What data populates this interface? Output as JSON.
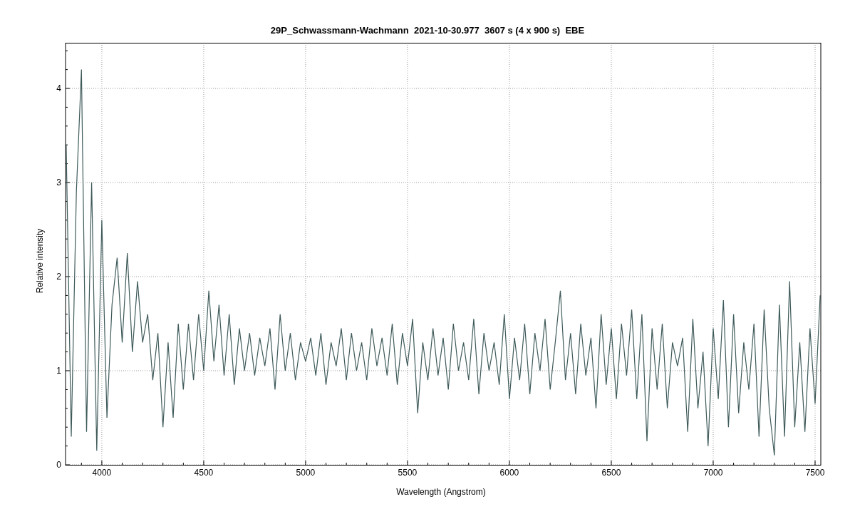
{
  "chart": {
    "chart_data": {
      "type": "line",
      "grid": true,
      "title": "29P_Schwassmann-Wachmann  2021-10-30.977  3607 s (4 x 900 s)  EBE",
      "xlabel": "Wavelength (Angstrom)",
      "ylabel": "Relative intensity",
      "xlim": [
        3822,
        7528
      ],
      "ylim": [
        0,
        4.485
      ],
      "xticks": [
        4000,
        4500,
        5000,
        5500,
        6000,
        6500,
        7000,
        7500
      ],
      "yticks": [
        0,
        1,
        2,
        3,
        4
      ],
      "x": [
        3825,
        3850,
        3875,
        3900,
        3925,
        3950,
        3975,
        4000,
        4025,
        4050,
        4075,
        4100,
        4125,
        4150,
        4175,
        4200,
        4225,
        4250,
        4275,
        4300,
        4325,
        4350,
        4375,
        4400,
        4425,
        4450,
        4475,
        4500,
        4525,
        4550,
        4575,
        4600,
        4625,
        4650,
        4675,
        4700,
        4725,
        4750,
        4775,
        4800,
        4825,
        4850,
        4875,
        4900,
        4925,
        4950,
        4975,
        5000,
        5025,
        5050,
        5075,
        5100,
        5125,
        5150,
        5175,
        5200,
        5225,
        5250,
        5275,
        5300,
        5325,
        5350,
        5375,
        5400,
        5425,
        5450,
        5475,
        5500,
        5525,
        5550,
        5575,
        5600,
        5625,
        5650,
        5675,
        5700,
        5725,
        5750,
        5775,
        5800,
        5825,
        5850,
        5875,
        5900,
        5925,
        5950,
        5975,
        6000,
        6025,
        6050,
        6075,
        6100,
        6125,
        6150,
        6175,
        6200,
        6225,
        6250,
        6275,
        6300,
        6325,
        6350,
        6375,
        6400,
        6425,
        6450,
        6475,
        6500,
        6525,
        6550,
        6575,
        6600,
        6625,
        6650,
        6675,
        6700,
        6725,
        6750,
        6775,
        6800,
        6825,
        6850,
        6875,
        6900,
        6925,
        6950,
        6975,
        7000,
        7025,
        7050,
        7075,
        7100,
        7125,
        7150,
        7175,
        7200,
        7225,
        7250,
        7275,
        7300,
        7325,
        7350,
        7375,
        7400,
        7425,
        7450,
        7475,
        7500,
        7525
      ],
      "series": [
        {
          "color": "#3f5a5a",
          "values": [
            3.4,
            0.3,
            2.9,
            4.2,
            0.35,
            3.0,
            0.15,
            2.6,
            0.5,
            1.7,
            2.2,
            1.3,
            2.25,
            1.2,
            1.95,
            1.3,
            1.6,
            0.9,
            1.4,
            0.4,
            1.3,
            0.5,
            1.5,
            0.8,
            1.5,
            0.9,
            1.6,
            1.0,
            1.85,
            1.1,
            1.7,
            0.95,
            1.6,
            0.85,
            1.45,
            1.0,
            1.4,
            0.95,
            1.35,
            1.05,
            1.45,
            0.8,
            1.6,
            1.0,
            1.4,
            0.9,
            1.3,
            1.1,
            1.35,
            0.95,
            1.4,
            0.85,
            1.3,
            1.05,
            1.45,
            0.9,
            1.4,
            1.0,
            1.3,
            0.9,
            1.45,
            1.05,
            1.35,
            0.95,
            1.5,
            0.85,
            1.4,
            1.05,
            1.55,
            0.55,
            1.3,
            0.9,
            1.45,
            0.95,
            1.35,
            0.8,
            1.5,
            1.0,
            1.3,
            0.9,
            1.55,
            0.75,
            1.4,
            1.0,
            1.3,
            0.85,
            1.6,
            0.7,
            1.35,
            0.9,
            1.5,
            0.75,
            1.4,
            1.0,
            1.55,
            0.8,
            1.3,
            1.85,
            0.9,
            1.4,
            0.75,
            1.5,
            0.95,
            1.35,
            0.6,
            1.6,
            0.85,
            1.45,
            0.7,
            1.5,
            0.95,
            1.65,
            0.7,
            1.6,
            0.25,
            1.45,
            0.8,
            1.5,
            0.6,
            1.3,
            1.05,
            1.35,
            0.35,
            1.55,
            0.6,
            1.2,
            0.2,
            1.45,
            0.7,
            1.75,
            0.4,
            1.6,
            0.55,
            1.3,
            0.8,
            1.5,
            0.3,
            1.65,
            0.6,
            0.1,
            1.7,
            0.3,
            1.95,
            0.4,
            1.3,
            0.35,
            1.45,
            0.65,
            1.8
          ]
        }
      ]
    }
  }
}
